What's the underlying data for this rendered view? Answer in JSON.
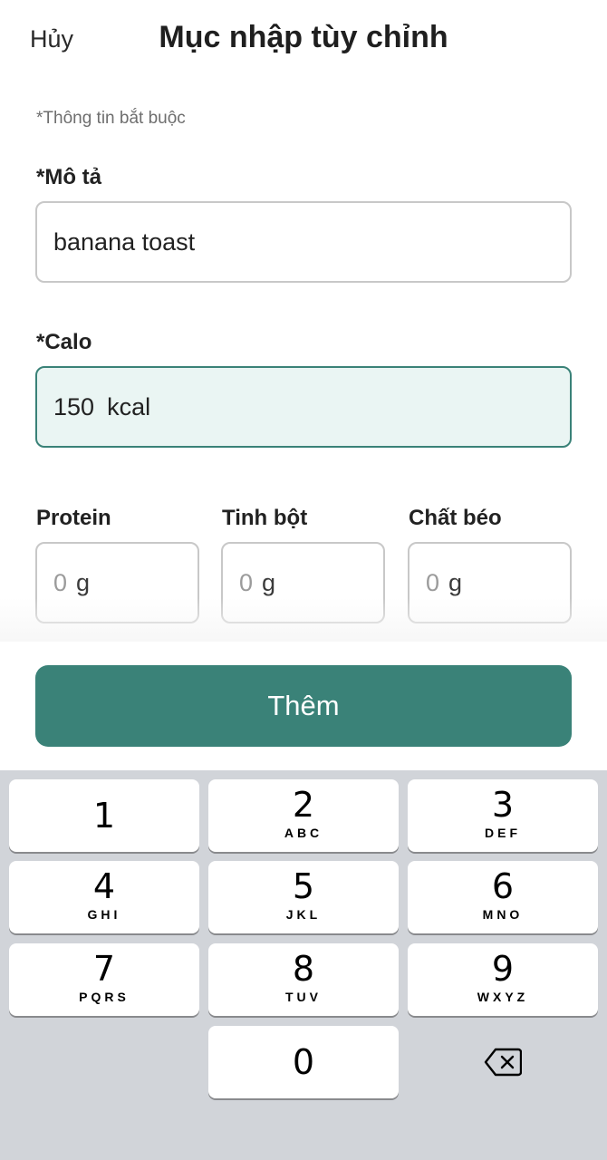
{
  "header": {
    "cancel_label": "Hủy",
    "title": "Mục nhập tùy chỉnh"
  },
  "form": {
    "required_note": "*Thông tin bắt buộc",
    "description": {
      "label": "*Mô tả",
      "value": "banana toast"
    },
    "calories": {
      "label": "*Calo",
      "value": "150",
      "unit": "kcal"
    },
    "macros": [
      {
        "label": "Protein",
        "value": "0",
        "unit": "g"
      },
      {
        "label": "Tinh bột",
        "value": "0",
        "unit": "g"
      },
      {
        "label": "Chất béo",
        "value": "0",
        "unit": "g"
      }
    ]
  },
  "add_button_label": "Thêm",
  "keyboard": {
    "keys": [
      {
        "digit": "1",
        "letters": ""
      },
      {
        "digit": "2",
        "letters": "ABC"
      },
      {
        "digit": "3",
        "letters": "DEF"
      },
      {
        "digit": "4",
        "letters": "GHI"
      },
      {
        "digit": "5",
        "letters": "JKL"
      },
      {
        "digit": "6",
        "letters": "MNO"
      },
      {
        "digit": "7",
        "letters": "PQRS"
      },
      {
        "digit": "8",
        "letters": "TUV"
      },
      {
        "digit": "9",
        "letters": "WXYZ"
      },
      {
        "digit": "0",
        "letters": ""
      }
    ],
    "backspace_icon": "backspace-icon"
  },
  "colors": {
    "accent": "#3a8278",
    "active_field_bg": "#eaf5f3",
    "keyboard_bg": "#d1d4d9"
  }
}
